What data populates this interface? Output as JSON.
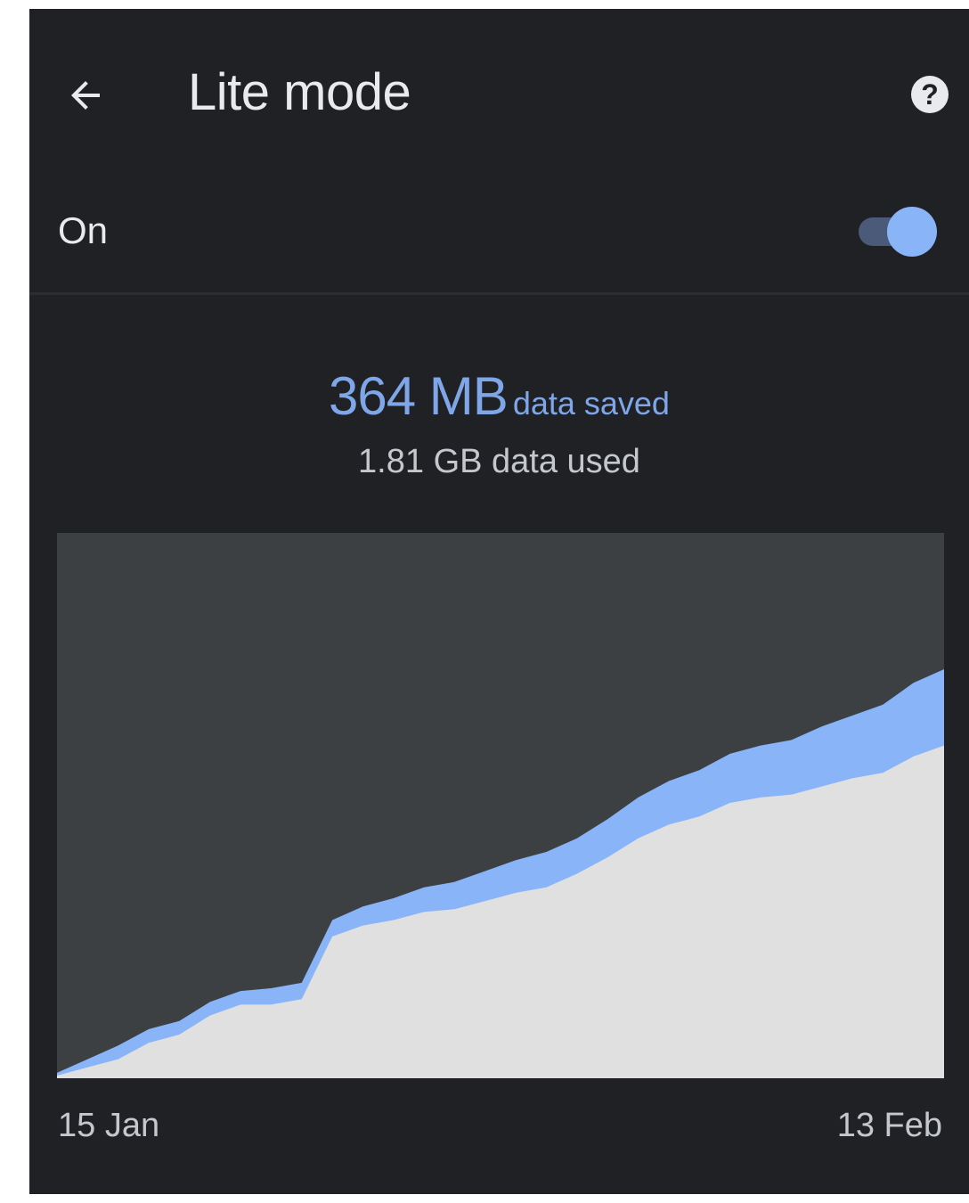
{
  "header": {
    "title": "Lite mode",
    "back_icon": "back-arrow-icon",
    "help_icon": "help-icon"
  },
  "toggle": {
    "label": "On",
    "state": true
  },
  "summary": {
    "saved_value": "364 MB",
    "saved_label": "data saved",
    "used_text": "1.81 GB data used"
  },
  "colors": {
    "background": "#202124",
    "plot_background": "#3c4043",
    "saved_fill": "#8ab4f8",
    "used_fill": "#e0e0e0",
    "accent_text": "#7ea6e8"
  },
  "chart_data": {
    "type": "area",
    "x_start_label": "15 Jan",
    "x_end_label": "13 Feb",
    "x": [
      0,
      1,
      2,
      3,
      4,
      5,
      6,
      7,
      8,
      9,
      10,
      11,
      12,
      13,
      14,
      15,
      16,
      17,
      18,
      19,
      20,
      21,
      22,
      23,
      24,
      25,
      26,
      27,
      28,
      29
    ],
    "series": [
      {
        "values": [
          0.5,
          2.0,
          3.5,
          6.5,
          8.0,
          11.5,
          13.5,
          13.5,
          14.5,
          26.0,
          28.0,
          29.0,
          30.5,
          31.0,
          32.5,
          34.0,
          35.0,
          37.5,
          40.5,
          44.0,
          46.5,
          48.0,
          50.5,
          51.5,
          52.0,
          53.5,
          55.0,
          56.0,
          59.0,
          61.0
        ]
      },
      {
        "values": [
          0.5,
          1.5,
          2.5,
          2.5,
          2.5,
          2.5,
          2.5,
          3.0,
          3.0,
          3.0,
          3.5,
          4.0,
          4.5,
          5.0,
          5.5,
          6.0,
          6.5,
          6.5,
          7.0,
          7.5,
          8.0,
          8.5,
          9.0,
          9.5,
          10.0,
          11.0,
          11.5,
          12.5,
          13.5,
          14.0
        ]
      }
    ],
    "stacked": true,
    "ylim": [
      0,
      100
    ],
    "grid": false,
    "legend": "none"
  }
}
